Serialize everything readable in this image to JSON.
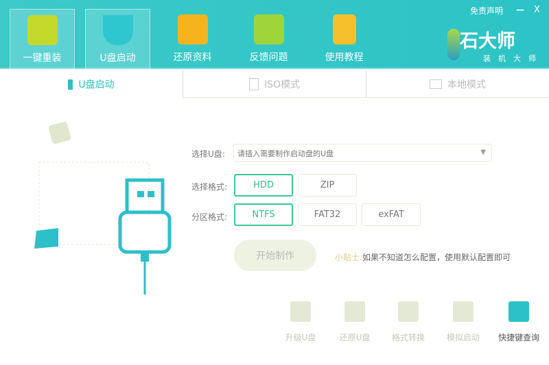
{
  "header": {
    "nav": [
      {
        "label": "一键重装",
        "color": "#c3d92c"
      },
      {
        "label": "U盘启动",
        "color": "#2ec7d0"
      },
      {
        "label": "还原资料",
        "color": "#f5b41e"
      },
      {
        "label": "反馈问题",
        "color": "#9fd43a"
      },
      {
        "label": "使用教程",
        "color": "#f6c02c"
      }
    ],
    "disclaimer": "免责声明",
    "minimize": "—",
    "close": "X",
    "logo_title": "石大师",
    "logo_sub": "装机大师"
  },
  "tabs": [
    {
      "label": "U盘启动"
    },
    {
      "label": "ISO模式"
    },
    {
      "label": "本地模式"
    }
  ],
  "form": {
    "select_label": "选择U盘:",
    "select_placeholder": "请插入需要制作启动盘的U盘",
    "format_label": "选择格式:",
    "formats": [
      "HDD",
      "ZIP"
    ],
    "partition_label": "分区格式:",
    "partitions": [
      "NTFS",
      "FAT32",
      "exFAT"
    ],
    "start": "开始制作",
    "tip_label": "小贴士:",
    "tip_text": "如果不知道怎么配置，使用默认配置即可"
  },
  "tools": [
    "升级U盘",
    "还原U盘",
    "格式转换",
    "模拟启动",
    "快捷键查询"
  ]
}
